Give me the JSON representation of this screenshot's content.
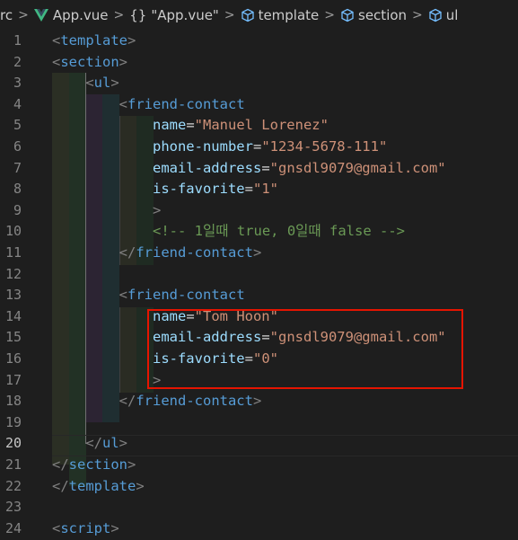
{
  "breadcrumb": {
    "items": [
      {
        "label": "rc",
        "icon": ""
      },
      {
        "label": "App.vue",
        "icon": "vue-icon"
      },
      {
        "label": "\"App.vue\"",
        "icon": "braces-icon"
      },
      {
        "label": "template",
        "icon": "cube-icon"
      },
      {
        "label": "section",
        "icon": "cube-icon"
      },
      {
        "label": "ul",
        "icon": "cube-icon"
      }
    ],
    "braces": "{}"
  },
  "colors": {
    "background": "#1e1e1e",
    "tag": "#569cd6",
    "attribute": "#9cdcfe",
    "string": "#ce9178",
    "comment": "#6a9955",
    "highlight_border": "#e51400",
    "vue_green": "#41b883"
  },
  "editor": {
    "active_line": 20,
    "lines": [
      {
        "n": "1",
        "tokens": [
          [
            "punct",
            "<"
          ],
          [
            "tag",
            "template"
          ],
          [
            "punct",
            ">"
          ]
        ]
      },
      {
        "n": "2",
        "tokens": [
          [
            "punct",
            "<"
          ],
          [
            "tag",
            "section"
          ],
          [
            "punct",
            ">"
          ]
        ]
      },
      {
        "n": "3",
        "tokens": [
          [
            "plain",
            "    "
          ],
          [
            "punct",
            "<"
          ],
          [
            "tag",
            "ul"
          ],
          [
            "punct",
            ">"
          ]
        ]
      },
      {
        "n": "4",
        "tokens": [
          [
            "plain",
            "        "
          ],
          [
            "punct",
            "<"
          ],
          [
            "tag",
            "friend-contact"
          ]
        ]
      },
      {
        "n": "5",
        "tokens": [
          [
            "plain",
            "            "
          ],
          [
            "attr",
            "name"
          ],
          [
            "eq",
            "="
          ],
          [
            "str",
            "\"Manuel Lorenez\""
          ]
        ]
      },
      {
        "n": "6",
        "tokens": [
          [
            "plain",
            "            "
          ],
          [
            "attr",
            "phone-number"
          ],
          [
            "eq",
            "="
          ],
          [
            "str",
            "\"1234-5678-111\""
          ]
        ]
      },
      {
        "n": "7",
        "tokens": [
          [
            "plain",
            "            "
          ],
          [
            "attr",
            "email-address"
          ],
          [
            "eq",
            "="
          ],
          [
            "str",
            "\"gnsdl9079@gmail.com\""
          ]
        ]
      },
      {
        "n": "8",
        "tokens": [
          [
            "plain",
            "            "
          ],
          [
            "attr",
            "is-favorite"
          ],
          [
            "eq",
            "="
          ],
          [
            "str",
            "\"1\""
          ]
        ]
      },
      {
        "n": "9",
        "tokens": [
          [
            "plain",
            "            "
          ],
          [
            "punct",
            ">"
          ]
        ]
      },
      {
        "n": "10",
        "tokens": [
          [
            "plain",
            "            "
          ],
          [
            "cmt",
            "<!-- 1일때 true, 0일때 false -->"
          ]
        ]
      },
      {
        "n": "11",
        "tokens": [
          [
            "plain",
            "        "
          ],
          [
            "punct",
            "</"
          ],
          [
            "tag",
            "friend-contact"
          ],
          [
            "punct",
            ">"
          ]
        ]
      },
      {
        "n": "12",
        "tokens": []
      },
      {
        "n": "13",
        "tokens": [
          [
            "plain",
            "        "
          ],
          [
            "punct",
            "<"
          ],
          [
            "tag",
            "friend-contact"
          ]
        ]
      },
      {
        "n": "14",
        "tokens": [
          [
            "plain",
            "            "
          ],
          [
            "attr",
            "name"
          ],
          [
            "eq",
            "="
          ],
          [
            "str",
            "\"Tom Hoon\""
          ]
        ]
      },
      {
        "n": "15",
        "tokens": [
          [
            "plain",
            "            "
          ],
          [
            "attr",
            "email-address"
          ],
          [
            "eq",
            "="
          ],
          [
            "str",
            "\"gnsdl9079@gmail.com\""
          ]
        ]
      },
      {
        "n": "16",
        "tokens": [
          [
            "plain",
            "            "
          ],
          [
            "attr",
            "is-favorite"
          ],
          [
            "eq",
            "="
          ],
          [
            "str",
            "\"0\""
          ]
        ]
      },
      {
        "n": "17",
        "tokens": [
          [
            "plain",
            "            "
          ],
          [
            "punct",
            ">"
          ]
        ]
      },
      {
        "n": "18",
        "tokens": [
          [
            "plain",
            "        "
          ],
          [
            "punct",
            "</"
          ],
          [
            "tag",
            "friend-contact"
          ],
          [
            "punct",
            ">"
          ]
        ]
      },
      {
        "n": "19",
        "tokens": []
      },
      {
        "n": "20",
        "tokens": [
          [
            "plain",
            "    "
          ],
          [
            "punct",
            "</"
          ],
          [
            "tag",
            "ul"
          ],
          [
            "punct",
            ">"
          ]
        ]
      },
      {
        "n": "21",
        "tokens": [
          [
            "punct",
            "</"
          ],
          [
            "tag",
            "section"
          ],
          [
            "punct",
            ">"
          ]
        ]
      },
      {
        "n": "22",
        "tokens": [
          [
            "punct",
            "</"
          ],
          [
            "tag",
            "template"
          ],
          [
            "punct",
            ">"
          ]
        ]
      },
      {
        "n": "23",
        "tokens": []
      },
      {
        "n": "24",
        "tokens": [
          [
            "punct",
            "<"
          ],
          [
            "tag",
            "script"
          ],
          [
            "punct",
            ">"
          ]
        ]
      }
    ]
  }
}
